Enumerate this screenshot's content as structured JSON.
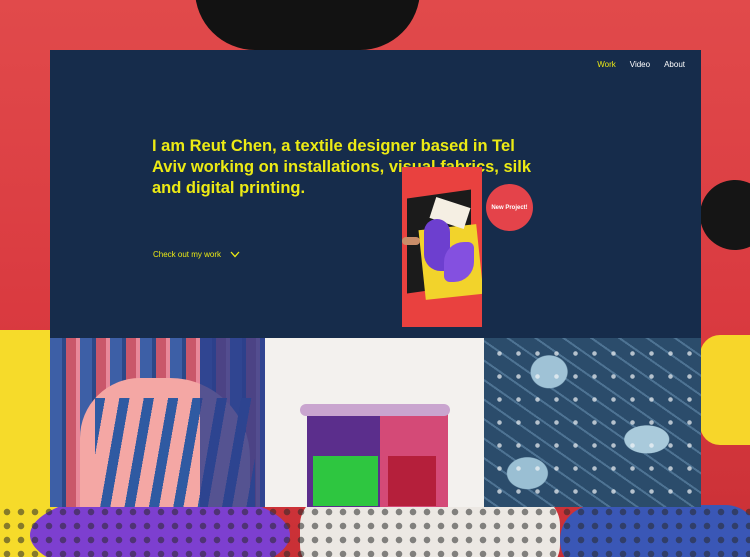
{
  "nav": {
    "items": [
      {
        "label": "Work",
        "active": true
      },
      {
        "label": "Video",
        "active": false
      },
      {
        "label": "About",
        "active": false
      }
    ]
  },
  "hero": {
    "intro": "I am Reut Chen, a textile designer based in Tel Aviv working on installations, visual fabrics, silk and digital printing.",
    "cta_label": "Check out my work",
    "cta_icon": "chevron-down-icon",
    "badge_label": "New Project!"
  },
  "colors": {
    "background": "#162c4b",
    "accent": "#ecea14",
    "badge": "#e4434a",
    "nav_text": "#ffffff"
  }
}
